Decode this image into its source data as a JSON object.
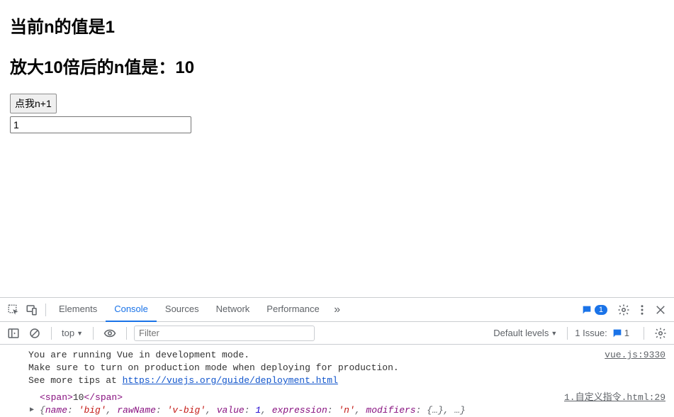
{
  "page": {
    "heading1_prefix": "当前n的值是",
    "heading1_value": "1",
    "heading2_prefix": "放大10倍后的n值是：",
    "heading2_value": "10",
    "button_label": "点我n+1",
    "input_value": "1"
  },
  "devtools": {
    "tabs": {
      "elements": "Elements",
      "console": "Console",
      "sources": "Sources",
      "network": "Network",
      "performance": "Performance"
    },
    "errors_count": "1",
    "filter": {
      "context": "top",
      "placeholder": "Filter",
      "levels": "Default levels",
      "issues_label": "1 Issue:",
      "issues_count": "1"
    },
    "log": {
      "vue_line1": "You are running Vue in development mode.",
      "vue_line2": "Make sure to turn on production mode when deploying for production.",
      "vue_line3_prefix": "See more tips at ",
      "vue_link": "https://vuejs.org/guide/deployment.html",
      "vue_src": "vue.js:9330",
      "span_open": "<span>",
      "span_val": "10",
      "span_close": "</span>",
      "span_src": "1.自定义指令.html:29",
      "obj": {
        "name_k": "name",
        "name_v": "'big'",
        "raw_k": "rawName",
        "raw_v": "'v-big'",
        "val_k": "value",
        "val_v": "1",
        "expr_k": "expression",
        "expr_v": "'n'",
        "mod_k": "modifiers",
        "mod_v": "{…}",
        "tail": ", …"
      }
    }
  }
}
